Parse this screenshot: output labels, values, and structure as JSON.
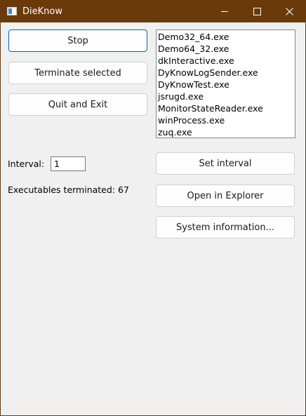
{
  "window": {
    "title": "DieKnow"
  },
  "colors": {
    "titlebar": "#6b3a0b",
    "background": "#f0f0f0",
    "button_focus_border": "#0067c0"
  },
  "icons": {
    "app": "window-app-icon",
    "minimize": "minimize-icon",
    "maximize": "maximize-icon",
    "close": "close-icon"
  },
  "buttons": {
    "stop": "Stop",
    "terminate_selected": "Terminate selected",
    "quit_and_exit": "Quit and Exit",
    "set_interval": "Set interval",
    "open_in_explorer": "Open in Explorer",
    "system_information": "System information..."
  },
  "executables": [
    "Demo32_64.exe",
    "Demo64_32.exe",
    "dkInteractive.exe",
    "DyKnowLogSender.exe",
    "DyKnowTest.exe",
    "jsrugd.exe",
    "MonitorStateReader.exe",
    "winProcess.exe",
    "zuq.exe"
  ],
  "interval": {
    "label": "Interval:",
    "value": "1"
  },
  "status": {
    "executables_terminated": "Executables terminated: 67"
  }
}
